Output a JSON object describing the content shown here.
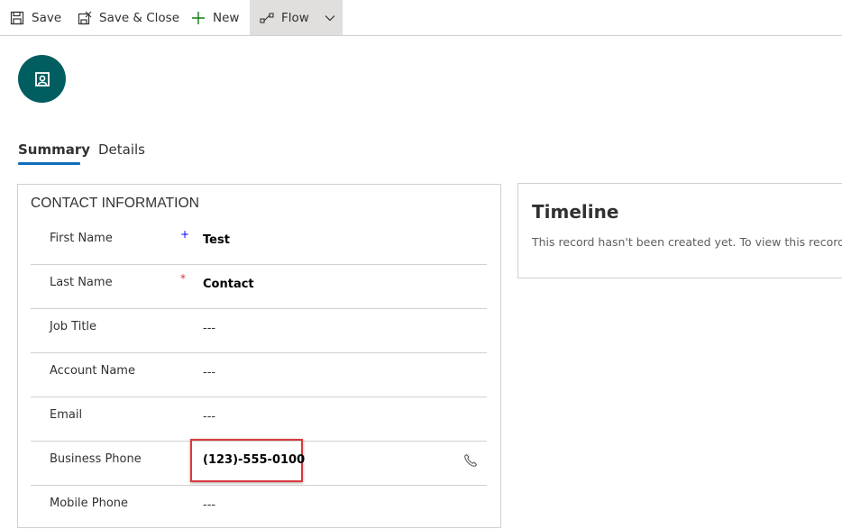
{
  "toolbar": {
    "save_label": "Save",
    "save_close_label": "Save & Close",
    "new_label": "New",
    "flow_label": "Flow"
  },
  "tabs": [
    {
      "label": "Summary",
      "active": true
    },
    {
      "label": "Details",
      "active": false
    }
  ],
  "contact_section": {
    "title": "CONTACT INFORMATION",
    "fields": [
      {
        "label": "First Name",
        "required_marker": "+",
        "value": "Test"
      },
      {
        "label": "Last Name",
        "required_marker": "*",
        "value": "Contact"
      },
      {
        "label": "Job Title",
        "value": "---"
      },
      {
        "label": "Account Name",
        "value": "---"
      },
      {
        "label": "Email",
        "value": "---"
      },
      {
        "label": "Business Phone",
        "value": "(123)-555-0100"
      },
      {
        "label": "Mobile Phone",
        "value": "---"
      }
    ]
  },
  "timeline": {
    "title": "Timeline",
    "message": "This record hasn't been created yet.  To view this record,"
  },
  "colors": {
    "avatar_bg": "#005e60",
    "accent_underline": "#0f6cbd",
    "highlight_border": "#d9393d",
    "required_red": "#d13438",
    "recommended_blue": "#0000ff"
  }
}
